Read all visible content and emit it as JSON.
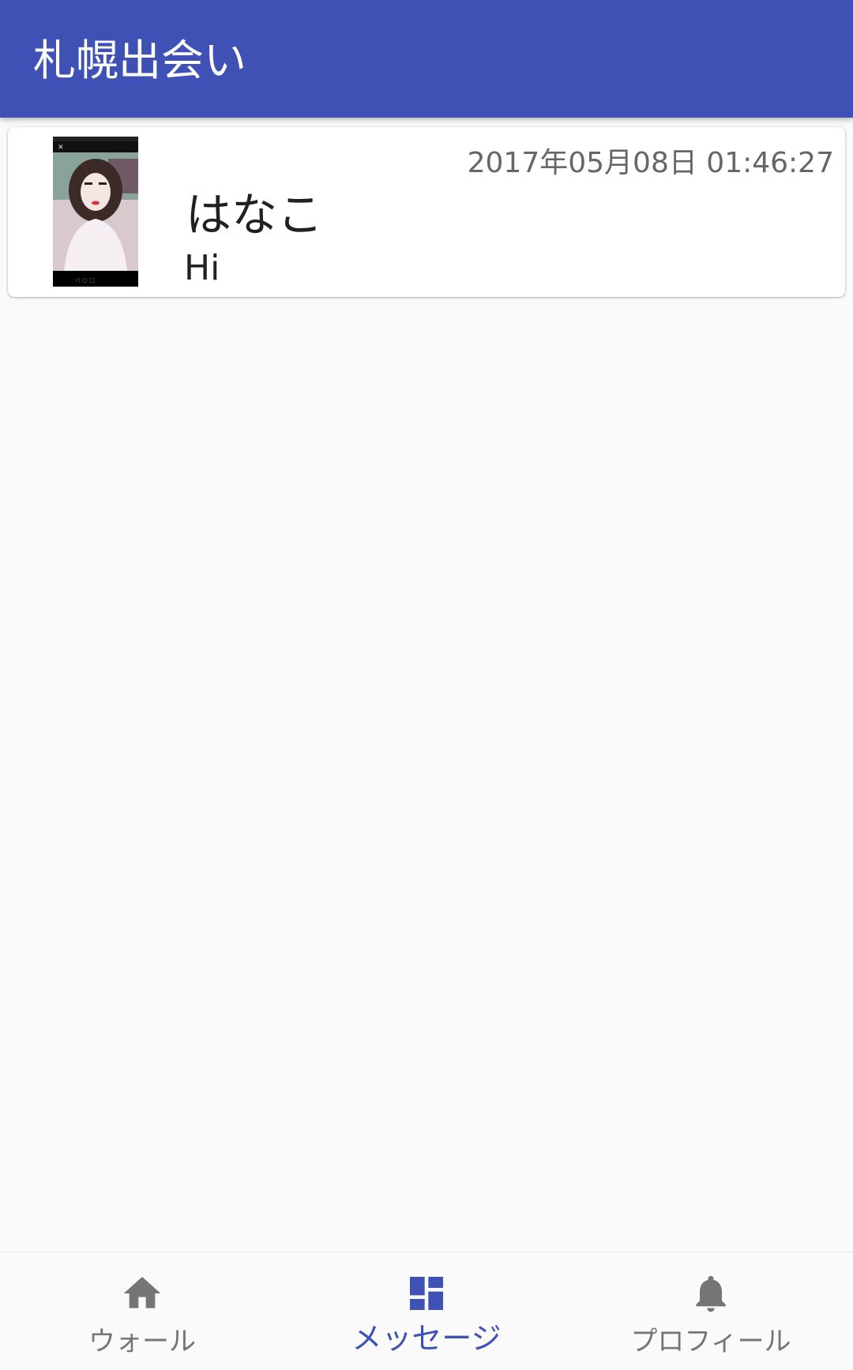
{
  "app_bar": {
    "title": "札幌出会い"
  },
  "conversations": [
    {
      "name": "はなこ",
      "last_message": "Hi",
      "timestamp": "2017年05月08日 01:46:27",
      "avatar": "user-photo"
    }
  ],
  "bottom_nav": {
    "active_index": 1,
    "items": [
      {
        "label": "ウォール",
        "icon": "home-icon"
      },
      {
        "label": "メッセージ",
        "icon": "dashboard-icon"
      },
      {
        "label": "プロフィール",
        "icon": "bell-icon"
      }
    ]
  },
  "colors": {
    "primary": "#3f51b5",
    "inactive": "#757575",
    "background": "#fafafa"
  }
}
